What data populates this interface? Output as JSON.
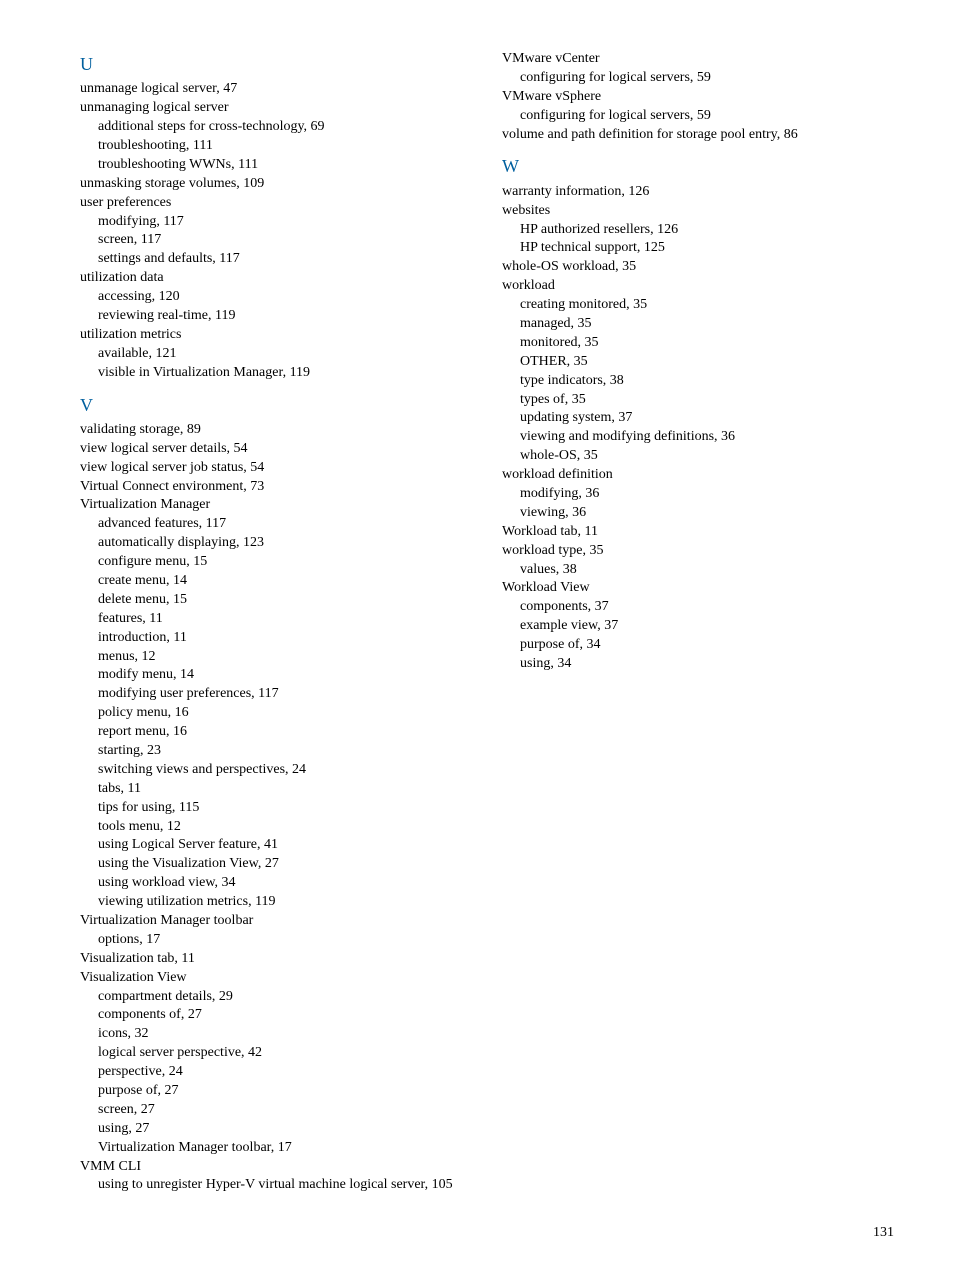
{
  "page_number": "131",
  "sections": [
    {
      "heading": "U",
      "entries": [
        {
          "type": "top",
          "text": "unmanage logical server, 47"
        },
        {
          "type": "top",
          "text": "unmanaging logical server"
        },
        {
          "type": "sub",
          "text": "additional steps for cross-technology, 69"
        },
        {
          "type": "sub",
          "text": "troubleshooting, 111"
        },
        {
          "type": "sub",
          "text": "troubleshooting WWNs, 111"
        },
        {
          "type": "top",
          "text": "unmasking storage volumes, 109"
        },
        {
          "type": "top",
          "text": "user preferences"
        },
        {
          "type": "sub",
          "text": "modifying, 117"
        },
        {
          "type": "sub",
          "text": "screen, 117"
        },
        {
          "type": "sub",
          "text": "settings and defaults, 117"
        },
        {
          "type": "top",
          "text": "utilization data"
        },
        {
          "type": "sub",
          "text": "accessing, 120"
        },
        {
          "type": "sub",
          "text": "reviewing real-time, 119"
        },
        {
          "type": "top",
          "text": "utilization metrics"
        },
        {
          "type": "sub",
          "text": "available, 121"
        },
        {
          "type": "sub",
          "text": "visible in Virtualization Manager, 119"
        }
      ]
    },
    {
      "heading": "V",
      "entries": [
        {
          "type": "top",
          "text": "validating storage, 89"
        },
        {
          "type": "top",
          "text": "view logical server details, 54"
        },
        {
          "type": "top",
          "text": "view logical server job status, 54"
        },
        {
          "type": "top",
          "text": "Virtual Connect environment, 73"
        },
        {
          "type": "top",
          "text": "Virtualization Manager"
        },
        {
          "type": "sub",
          "text": "advanced features, 117"
        },
        {
          "type": "sub",
          "text": "automatically displaying, 123"
        },
        {
          "type": "sub",
          "text": "configure menu, 15"
        },
        {
          "type": "sub",
          "text": "create menu, 14"
        },
        {
          "type": "sub",
          "text": "delete menu, 15"
        },
        {
          "type": "sub",
          "text": "features, 11"
        },
        {
          "type": "sub",
          "text": "introduction, 11"
        },
        {
          "type": "sub",
          "text": "menus, 12"
        },
        {
          "type": "sub",
          "text": "modify menu, 14"
        },
        {
          "type": "sub",
          "text": "modifying user preferences, 117"
        },
        {
          "type": "sub",
          "text": "policy menu, 16"
        },
        {
          "type": "sub",
          "text": "report menu, 16"
        },
        {
          "type": "sub",
          "text": "starting, 23"
        },
        {
          "type": "sub",
          "text": "switching views and perspectives, 24"
        },
        {
          "type": "sub",
          "text": "tabs, 11"
        },
        {
          "type": "sub",
          "text": "tips for using, 115"
        },
        {
          "type": "sub",
          "text": "tools menu, 12"
        },
        {
          "type": "sub",
          "text": "using Logical Server feature, 41"
        },
        {
          "type": "sub",
          "text": "using the Visualization View, 27"
        },
        {
          "type": "sub",
          "text": "using workload view, 34"
        },
        {
          "type": "sub",
          "text": "viewing utilization metrics, 119"
        },
        {
          "type": "top",
          "text": "Virtualization Manager toolbar"
        },
        {
          "type": "sub",
          "text": "options, 17"
        },
        {
          "type": "top",
          "text": "Visualization tab, 11"
        },
        {
          "type": "top",
          "text": "Visualization View"
        },
        {
          "type": "sub",
          "text": "compartment details, 29"
        },
        {
          "type": "sub",
          "text": "components of, 27"
        },
        {
          "type": "sub",
          "text": "icons, 32"
        },
        {
          "type": "sub",
          "text": "logical server perspective, 42"
        },
        {
          "type": "sub",
          "text": "perspective, 24"
        },
        {
          "type": "sub",
          "text": "purpose of, 27"
        },
        {
          "type": "sub",
          "text": "screen, 27"
        },
        {
          "type": "sub",
          "text": "using, 27"
        },
        {
          "type": "sub",
          "text": "Virtualization Manager toolbar, 17"
        },
        {
          "type": "top",
          "text": "VMM CLI"
        },
        {
          "type": "sub",
          "text": "using to unregister Hyper-V virtual machine logical server, 105"
        },
        {
          "type": "top",
          "text": "VMware vCenter"
        },
        {
          "type": "sub",
          "text": "configuring for logical servers, 59"
        },
        {
          "type": "top",
          "text": "VMware vSphere"
        },
        {
          "type": "sub",
          "text": "configuring for logical servers, 59"
        },
        {
          "type": "top",
          "text": "volume and path definition for storage pool entry, 86"
        }
      ]
    },
    {
      "heading": "W",
      "entries": [
        {
          "type": "top",
          "text": "warranty information, 126"
        },
        {
          "type": "top",
          "text": "websites"
        },
        {
          "type": "sub",
          "text": "HP authorized resellers, 126"
        },
        {
          "type": "sub",
          "text": "HP technical support, 125"
        },
        {
          "type": "top",
          "text": "whole-OS workload, 35"
        },
        {
          "type": "top",
          "text": "workload"
        },
        {
          "type": "sub",
          "text": "creating monitored, 35"
        },
        {
          "type": "sub",
          "text": "managed, 35"
        },
        {
          "type": "sub",
          "text": "monitored, 35"
        },
        {
          "type": "sub",
          "text": "OTHER, 35"
        },
        {
          "type": "sub",
          "text": "type indicators, 38"
        },
        {
          "type": "sub",
          "text": "types of, 35"
        },
        {
          "type": "sub",
          "text": "updating system, 37"
        },
        {
          "type": "sub",
          "text": "viewing and modifying definitions, 36"
        },
        {
          "type": "sub",
          "text": "whole-OS, 35"
        },
        {
          "type": "top",
          "text": "workload definition"
        },
        {
          "type": "sub",
          "text": "modifying, 36"
        },
        {
          "type": "sub",
          "text": "viewing, 36"
        },
        {
          "type": "top",
          "text": "Workload tab, 11"
        },
        {
          "type": "top",
          "text": "workload type, 35"
        },
        {
          "type": "sub",
          "text": "values, 38"
        },
        {
          "type": "top",
          "text": "Workload View"
        },
        {
          "type": "sub",
          "text": "components, 37"
        },
        {
          "type": "sub",
          "text": "example view, 37"
        },
        {
          "type": "sub",
          "text": "purpose of, 34"
        },
        {
          "type": "sub",
          "text": "using, 34"
        }
      ]
    }
  ]
}
